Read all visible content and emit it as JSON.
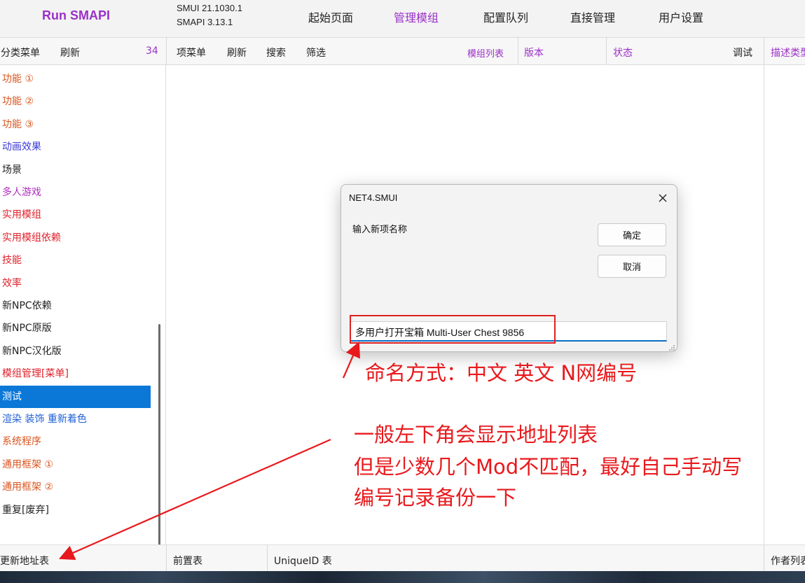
{
  "header": {
    "app_title": "Run SMAPI",
    "smui_version": "SMUI 21.1030.1",
    "smapi_version": "SMAPI 3.13.1",
    "tabs": [
      "起始页面",
      "管理模组",
      "配置队列",
      "直接管理",
      "用户设置"
    ],
    "active_tab": "管理模组"
  },
  "toolbar": {
    "category_menu": "分类菜单",
    "refresh_left": "刷新",
    "count": "34",
    "item_menu": "项菜单",
    "refresh": "刷新",
    "search": "搜索",
    "filter": "筛选",
    "mod_list": "模组列表",
    "col_version": "版本",
    "col_status": "状态",
    "col_debug": "调试",
    "col_desc": "描述类型"
  },
  "sidebar": {
    "categories": [
      {
        "label": "功能 ①",
        "color": "#d9541e"
      },
      {
        "label": "功能 ②",
        "color": "#d9541e"
      },
      {
        "label": "功能 ③",
        "color": "#d9541e"
      },
      {
        "label": "动画效果",
        "color": "#3b3bd4"
      },
      {
        "label": "场景",
        "color": "#222222"
      },
      {
        "label": "多人游戏",
        "color": "#b02cc0"
      },
      {
        "label": "实用模组",
        "color": "#e0202a"
      },
      {
        "label": "实用模组依赖",
        "color": "#e0202a"
      },
      {
        "label": "技能",
        "color": "#e0202a"
      },
      {
        "label": "效率",
        "color": "#e0202a"
      },
      {
        "label": "新NPC依赖",
        "color": "#222222"
      },
      {
        "label": "新NPC原版",
        "color": "#222222"
      },
      {
        "label": "新NPC汉化版",
        "color": "#222222"
      },
      {
        "label": "模组管理[菜单]",
        "color": "#e0202a"
      },
      {
        "label": "测试",
        "color": "#ffffff",
        "selected": true
      },
      {
        "label": "渲染 装饰 重新着色",
        "color": "#1e5fd6"
      },
      {
        "label": "系统程序",
        "color": "#d9541e"
      },
      {
        "label": "通用框架 ①",
        "color": "#d9541e"
      },
      {
        "label": "通用框架 ②",
        "color": "#d9541e"
      },
      {
        "label": "重复[废弃]",
        "color": "#222222"
      }
    ]
  },
  "footer": {
    "update_address": "更新地址表",
    "prereq_table": "前置表",
    "uniqueid_table": "UniqueID 表",
    "author_list": "作者列表"
  },
  "dialog": {
    "title": "NET4.SMUI",
    "prompt": "输入新项名称",
    "ok_label": "确定",
    "cancel_label": "取消",
    "input_value": "多用户打开宝箱 Multi-User Chest 9856"
  },
  "annotations": {
    "naming_note": "命名方式：中文 英文 N网编号",
    "note_line1": "一般左下角会显示地址列表",
    "note_line2": "但是少数几个Mod不匹配，最好自己手动写",
    "note_line3": "编号记录备份一下"
  },
  "colors": {
    "accent_purple": "#9b30c8",
    "selection_blue": "#0b78d7",
    "annotation_red": "#e8191c"
  }
}
